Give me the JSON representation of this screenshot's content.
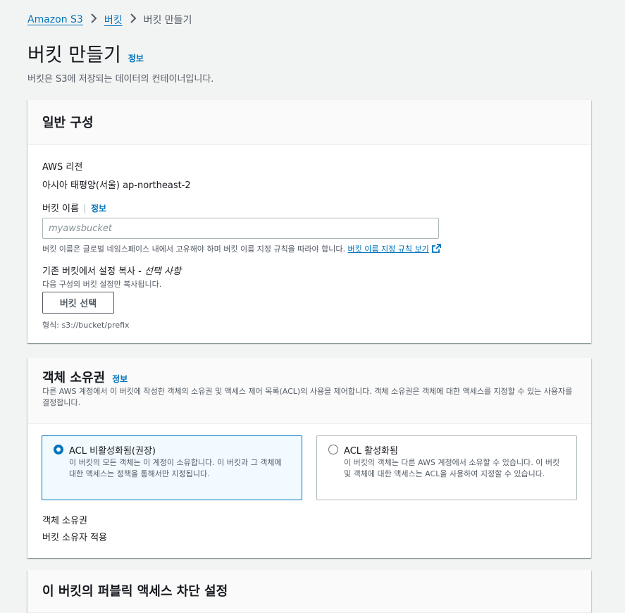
{
  "breadcrumb": {
    "items": [
      "Amazon S3",
      "버킷"
    ],
    "current": "버킷 만들기"
  },
  "page": {
    "title": "버킷 만들기",
    "info": "정보",
    "description": "버킷은 S3에 저장되는 데이터의 컨테이너입니다."
  },
  "general": {
    "title": "일반 구성",
    "region_label": "AWS 리전",
    "region_value": "아시아 태평양(서울) ap-northeast-2",
    "bucket_name_label": "버킷 이름",
    "bucket_name_info": "정보",
    "bucket_name_placeholder": "myawsbucket",
    "bucket_name_hint": "버킷 이름은 글로벌 네임스페이스 내에서 고유해야 하며 버킷 이름 지정 규칙을 따라야 합니다.",
    "naming_rules_link": "버킷 이름 지정 규칙 보기",
    "copy_label": "기존 버킷에서 설정 복사 -",
    "copy_optional": "선택 사항",
    "copy_hint": "다음 구성의 버킷 설정만 복사됩니다.",
    "choose_button": "버킷 선택",
    "format_hint": "형식: s3://bucket/prefix"
  },
  "ownership": {
    "title": "객체 소유권",
    "info": "정보",
    "description": "다른 AWS 계정에서 이 버킷에 작성한 객체의 소유권 및 액세스 제어 목록(ACL)의 사용을 제어합니다. 객체 소유권은 객체에 대한 액세스를 지정할 수 있는 사용자를 결정합니다.",
    "options": [
      {
        "title": "ACL 비활성화됨(권장)",
        "description": "이 버킷의 모든 객체는 이 계정이 소유합니다. 이 버킷과 그 객체에 대한 액세스는 정책을 통해서만 지정됩니다.",
        "selected": true
      },
      {
        "title": "ACL 활성화됨",
        "description": "이 버킷의 객체는 다른 AWS 계정에서 소유할 수 있습니다. 이 버킷 및 객체에 대한 액세스는 ACL을 사용하여 지정할 수 있습니다.",
        "selected": false
      }
    ],
    "owner_label": "객체 소유권",
    "owner_value": "버킷 소유자 적용"
  },
  "next_section": {
    "title": "이 버킷의 퍼블릭 액세스 차단 설정"
  },
  "colors": {
    "link": "#0073bb",
    "selected_bg": "#f1faff",
    "text": "#16191f",
    "muted": "#545b64"
  },
  "icons": {
    "breadcrumb_separator": "chevron-right-icon",
    "external_link": "external-link-icon"
  }
}
